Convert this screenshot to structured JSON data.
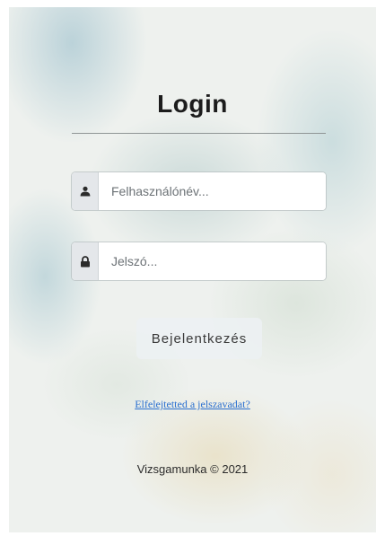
{
  "login": {
    "title": "Login",
    "username": {
      "icon": "user-icon",
      "placeholder": "Felhasználónév...",
      "value": ""
    },
    "password": {
      "icon": "lock-icon",
      "placeholder": "Jelszó...",
      "value": ""
    },
    "submit_label": "Bejelentkezés",
    "forgot_link": "Elfelejtetted a jelszavadat?"
  },
  "footer": {
    "text": "Vizsgamunka © 2021"
  },
  "colors": {
    "link": "#2a6fd0",
    "addon_bg": "#e4e7ea",
    "title": "#1c1c1c"
  }
}
